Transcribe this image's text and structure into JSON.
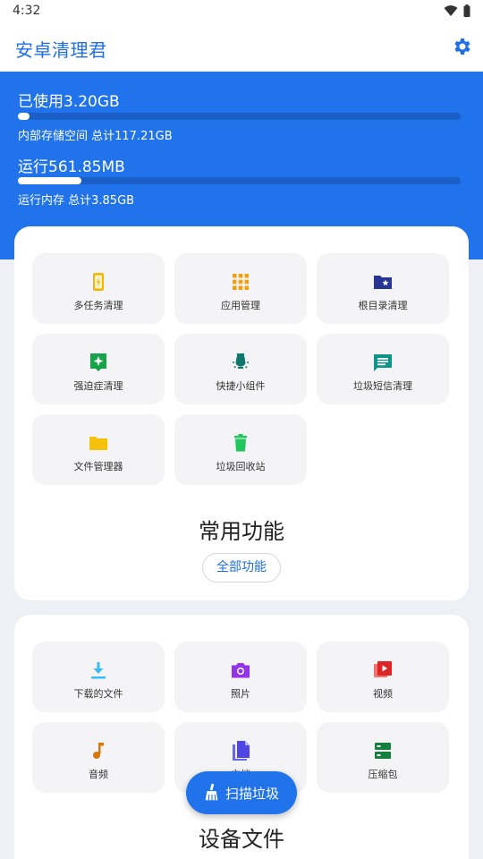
{
  "status": {
    "time": "4:32"
  },
  "app": {
    "title": "安卓清理君"
  },
  "storage": {
    "used_label": "已使用3.20GB",
    "used_fraction": 0.027,
    "detail": "内部存储空间 总计117.21GB"
  },
  "memory": {
    "running_label": "运行561.85MB",
    "running_fraction": 0.143,
    "detail": "运行内存 总计3.85GB"
  },
  "common": {
    "title": "常用功能",
    "all_button": "全部功能",
    "items": [
      {
        "label": "多任务清理",
        "icon": "phone-bolt-icon",
        "color": "#f4b400"
      },
      {
        "label": "应用管理",
        "icon": "apps-grid-icon",
        "color": "#f59e0b"
      },
      {
        "label": "根目录清理",
        "icon": "folder-star-icon",
        "color": "#283593"
      },
      {
        "label": "强迫症清理",
        "icon": "sparkle-chat-icon",
        "color": "#16a34a"
      },
      {
        "label": "快捷小组件",
        "icon": "lamp-widget-icon",
        "color": "#0f766e"
      },
      {
        "label": "垃圾短信清理",
        "icon": "message-icon",
        "color": "#0d9488"
      },
      {
        "label": "文件管理器",
        "icon": "folder-icon",
        "color": "#f4c20d"
      },
      {
        "label": "垃圾回收站",
        "icon": "trash-icon",
        "color": "#22c55e"
      }
    ]
  },
  "device": {
    "title": "设备文件",
    "items": [
      {
        "label": "下载的文件",
        "icon": "download-icon",
        "color": "#38bdf8"
      },
      {
        "label": "照片",
        "icon": "camera-icon",
        "color": "#9333ea"
      },
      {
        "label": "视频",
        "icon": "video-icon",
        "color": "#dc2626"
      },
      {
        "label": "音频",
        "icon": "music-note-icon",
        "color": "#d97706"
      },
      {
        "label": "文档",
        "icon": "document-icon",
        "color": "#4f46e5"
      },
      {
        "label": "压缩包",
        "icon": "archive-icon",
        "color": "#15803d"
      }
    ]
  },
  "fab": {
    "label": "扫描垃圾"
  }
}
